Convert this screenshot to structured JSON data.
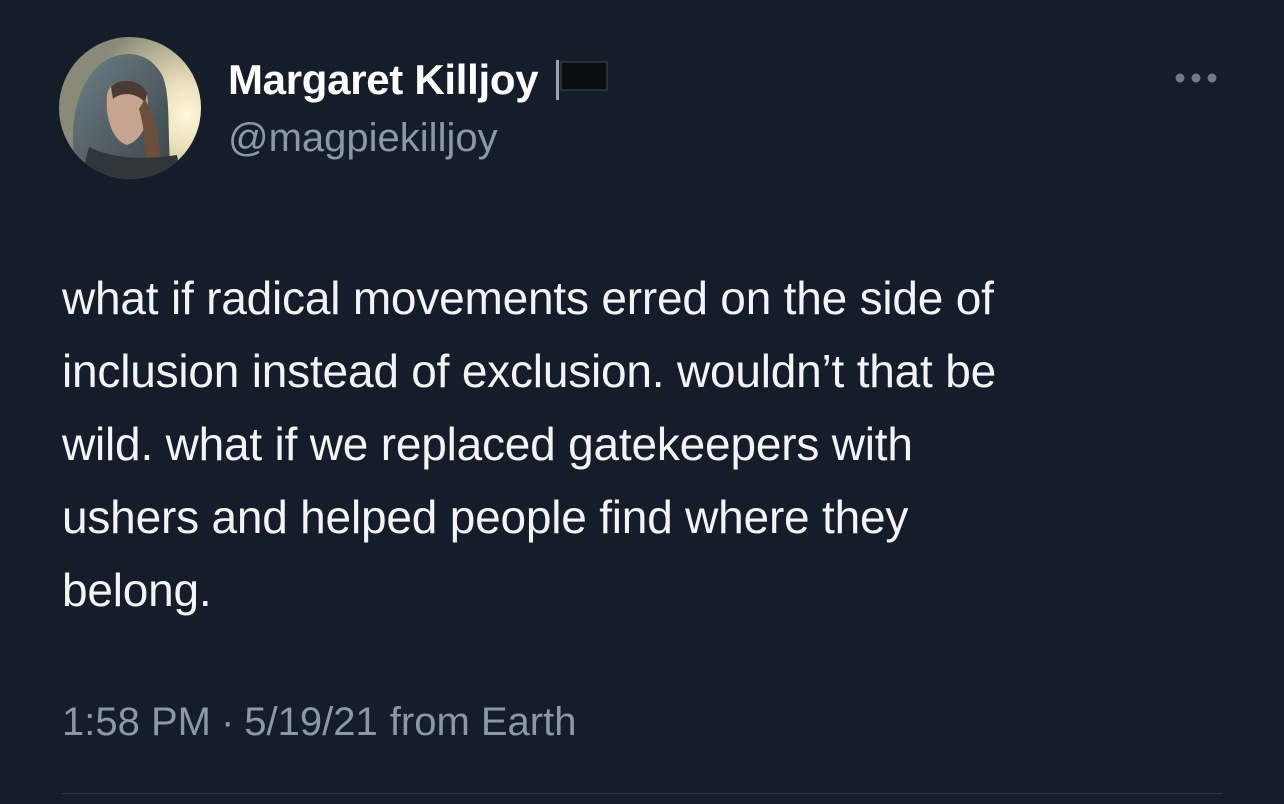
{
  "author": {
    "display_name": "Margaret Killjoy",
    "handle": "@magpiekilljoy",
    "name_badge_icon": "black-flag-icon"
  },
  "tweet": {
    "text": "what if radical movements erred on the side of\ninclusion instead of exclusion. wouldn’t that be\nwild. what if we replaced gatekeepers with\nushers and helped people find where they\nbelong.",
    "time": "1:58 PM",
    "separator": "·",
    "date": "5/19/21",
    "source": "from Earth"
  },
  "actions": {
    "more_icon": "more-horizontal-icon"
  },
  "theme": {
    "background": "#151d2a",
    "text_primary": "#ffffff",
    "text_secondary": "#8b98a5",
    "divider": "#2f3842"
  }
}
